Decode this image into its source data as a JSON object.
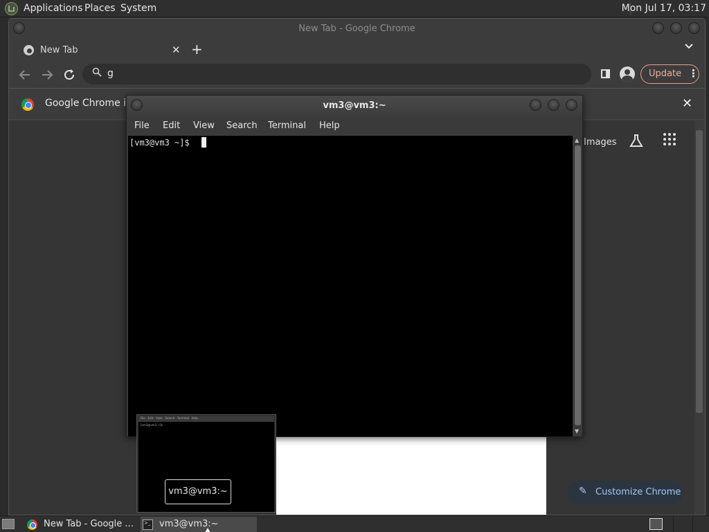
{
  "top_panel": {
    "menus": [
      "Applications",
      "Places",
      "System"
    ],
    "clock": "Mon Jul 17, 03:17"
  },
  "chrome": {
    "window_title": "New Tab - Google Chrome",
    "tab": {
      "label": "New Tab",
      "close": "✕"
    },
    "new_tab": "+",
    "tab_list": "⌄",
    "omnibox": {
      "value": "g"
    },
    "update_label": "Update",
    "menu_dots": "⋮",
    "infobar_text": "Google Chrome isn",
    "infobar_close": "✕",
    "ntp": {
      "images_link": "Images",
      "customize_label": "Customize Chrome"
    }
  },
  "terminal": {
    "window_title": "vm3@vm3:~",
    "menus": [
      "File",
      "Edit",
      "View",
      "Search",
      "Terminal",
      "Help"
    ],
    "prompt": "[vm3@vm3 ~]$ "
  },
  "preview": {
    "caption": "vm3@vm3:~",
    "mini_menus": "File   Edit   View   Search   Terminal   Help",
    "mini_prompt": "[vm3@vm3 ~]$"
  },
  "bottom_panel": {
    "tasks": [
      {
        "label": "New Tab - Google ...",
        "icon": "chrome-icon"
      },
      {
        "label": "vm3@vm3:~",
        "icon": "terminal-icon"
      }
    ]
  },
  "colors": {
    "accent_blue": "#a8c7fa",
    "update_pink": "#f0b0a0",
    "terminal_bg": "#000000"
  }
}
